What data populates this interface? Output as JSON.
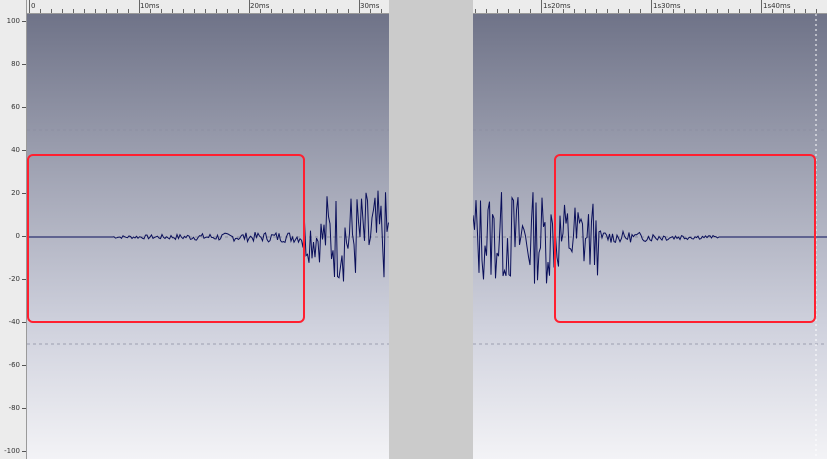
{
  "y_axis": {
    "labels": [
      "100",
      "80",
      "60",
      "40",
      "20",
      "0",
      "-20",
      "-40",
      "-60",
      "-80",
      "-100"
    ]
  },
  "left_time_axis": {
    "labels": [
      "0",
      "10ms",
      "20ms",
      "30ms"
    ]
  },
  "right_time_axis": {
    "labels": [
      "1s20ms",
      "1s30ms",
      "1s40ms"
    ]
  },
  "colors": {
    "waveform": "#0a0f5a",
    "highlight": "#ff2030",
    "grid": "#8a8da0"
  }
}
